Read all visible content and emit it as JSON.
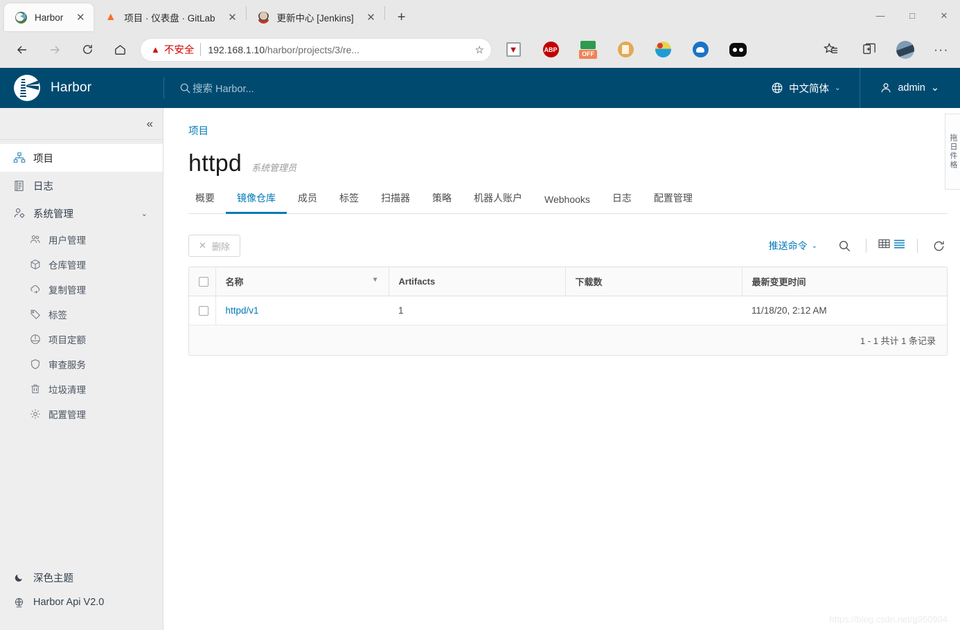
{
  "browser": {
    "tabs": [
      {
        "title": "Harbor",
        "favicon": "harbor-favicon",
        "active": true
      },
      {
        "title": "项目 · 仪表盘 · GitLab",
        "favicon": "gitlab-favicon",
        "active": false
      },
      {
        "title": "更新中心 [Jenkins]",
        "favicon": "jenkins-favicon",
        "active": false
      }
    ],
    "new_tab_label": "+",
    "close_label": "✕",
    "window_controls": {
      "minimize": "—",
      "maximize": "□",
      "close": "✕"
    },
    "address_bar": {
      "security_icon": "warning-triangle-icon",
      "security_label": "不安全",
      "url_host": "192.168.1.10",
      "url_path": "/harbor/projects/3/re...",
      "bookmark_icon": "star-icon"
    },
    "extensions": [
      {
        "name": "ublock-origin-extension-icon",
        "label": ""
      },
      {
        "name": "adblock-plus-extension-icon",
        "label": "ABP"
      },
      {
        "name": "toggle-off-extension-icon",
        "label": "OFF"
      },
      {
        "name": "document-extension-icon",
        "label": ""
      },
      {
        "name": "fruit-extension-icon",
        "label": ""
      },
      {
        "name": "cloud-extension-icon",
        "label": ""
      },
      {
        "name": "black-pill-extension-icon",
        "label": ""
      }
    ],
    "toolbar_right": {
      "favorites_icon": "favorites-star-icon",
      "collections_icon": "collections-icon",
      "profile_icon": "profile-avatar",
      "settings_icon": "more-options-icon",
      "more_label": "···"
    }
  },
  "header": {
    "brand": "Harbor",
    "logo_icon": "harbor-lighthouse-logo",
    "search_placeholder": "搜索 Harbor...",
    "search_icon": "search-icon",
    "language": {
      "label": "中文简体",
      "icon": "globe-icon",
      "caret": "⌄"
    },
    "user": {
      "label": "admin",
      "icon": "user-icon",
      "caret": "⌄"
    }
  },
  "sidebar": {
    "collapse_icon": "collapse-chevrons-icon",
    "collapse_glyph": "«",
    "items": [
      {
        "label": "项目",
        "icon": "projects-icon",
        "active": true
      },
      {
        "label": "日志",
        "icon": "logs-icon",
        "active": false
      },
      {
        "label": "系统管理",
        "icon": "administration-icon",
        "active": false,
        "expandable": true,
        "caret": "⌄"
      }
    ],
    "sub_items": [
      {
        "label": "用户管理",
        "icon": "users-icon"
      },
      {
        "label": "仓库管理",
        "icon": "registry-icon"
      },
      {
        "label": "复制管理",
        "icon": "replication-icon"
      },
      {
        "label": "标签",
        "icon": "labels-tag-icon"
      },
      {
        "label": "项目定额",
        "icon": "project-quota-icon"
      },
      {
        "label": "审查服务",
        "icon": "interrogation-shield-icon"
      },
      {
        "label": "垃圾清理",
        "icon": "garbage-collection-trash-icon"
      },
      {
        "label": "配置管理",
        "icon": "configuration-gear-icon"
      }
    ],
    "bottom_items": [
      {
        "label": "深色主题",
        "icon": "moon-dark-theme-icon"
      },
      {
        "label": "Harbor Api V2.0",
        "icon": "api-globe-icon"
      }
    ]
  },
  "main": {
    "breadcrumb": "项目",
    "project_name": "httpd",
    "project_role": "系统管理员",
    "tabs": [
      {
        "label": "概要",
        "selected": false
      },
      {
        "label": "镜像仓库",
        "selected": true
      },
      {
        "label": "成员",
        "selected": false
      },
      {
        "label": "标签",
        "selected": false
      },
      {
        "label": "扫描器",
        "selected": false
      },
      {
        "label": "策略",
        "selected": false
      },
      {
        "label": "机器人账户",
        "selected": false
      },
      {
        "label": "Webhooks",
        "selected": false
      },
      {
        "label": "日志",
        "selected": false
      },
      {
        "label": "配置管理",
        "selected": false
      }
    ],
    "toolbar": {
      "delete_label": "删除",
      "delete_icon": "close-x-icon",
      "push_command_label": "推送命令",
      "push_command_caret": "⌄",
      "search_icon": "search-icon",
      "view_grid_icon": "grid-view-icon",
      "view_list_icon": "list-view-icon",
      "refresh_icon": "refresh-icon"
    },
    "table": {
      "columns": [
        "名称",
        "Artifacts",
        "下载数",
        "最新变更时间"
      ],
      "sort_filter_icon": "filter-funnel-icon",
      "rows": [
        {
          "name": "httpd/v1",
          "artifacts": "1",
          "downloads": "",
          "modified": "11/18/20, 2:12 AM"
        }
      ],
      "pagination": "1 - 1 共计 1 条记录"
    },
    "side_strip_label": "拖日件格"
  },
  "watermark": "https://blog.csdn.net/g950904",
  "colors": {
    "harbor_header": "#004a70",
    "accent_blue": "#0079b8",
    "sidebar_bg": "#eeeeee",
    "browser_chrome": "#e8e8e8",
    "insecure_red": "#d40000"
  }
}
